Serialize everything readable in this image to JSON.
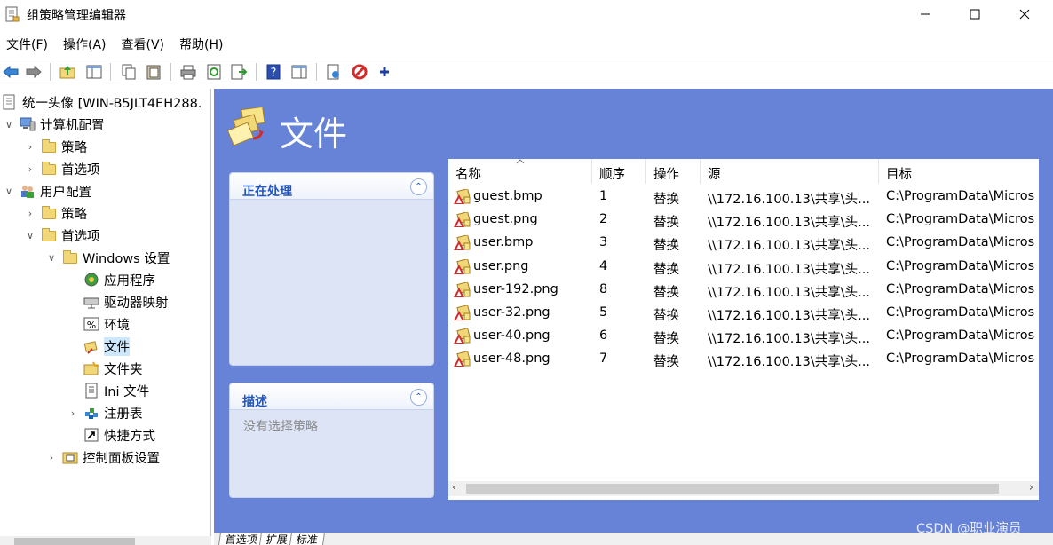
{
  "window": {
    "title": "组策略管理编辑器"
  },
  "menu": [
    "文件(F)",
    "操作(A)",
    "查看(V)",
    "帮助(H)"
  ],
  "tree": {
    "root": "统一头像 [WIN-B5JLT4EH288.",
    "computer_config": "计算机配置",
    "policies": "策略",
    "preferences": "首选项",
    "user_config": "用户配置",
    "user_policies": "策略",
    "user_preferences": "首选项",
    "windows_settings": "Windows 设置",
    "applications": "应用程序",
    "drive_maps": "驱动器映射",
    "environment": "环境",
    "files": "文件",
    "folders": "文件夹",
    "ini_files": "Ini 文件",
    "registry": "注册表",
    "shortcuts": "快捷方式",
    "control_panel": "控制面板设置"
  },
  "header": {
    "title": "文件"
  },
  "panels": {
    "processing_title": "正在处理",
    "description_title": "描述",
    "description_text": "没有选择策略"
  },
  "columns": {
    "name": "名称",
    "order": "顺序",
    "action": "操作",
    "source": "源",
    "target": "目标"
  },
  "rows": [
    {
      "name": "guest.bmp",
      "order": "1",
      "action": "替换",
      "source": "\\\\172.16.100.13\\共享\\头...",
      "target": "C:\\ProgramData\\Micros"
    },
    {
      "name": "guest.png",
      "order": "2",
      "action": "替换",
      "source": "\\\\172.16.100.13\\共享\\头...",
      "target": "C:\\ProgramData\\Micros"
    },
    {
      "name": "user.bmp",
      "order": "3",
      "action": "替换",
      "source": "\\\\172.16.100.13\\共享\\头...",
      "target": "C:\\ProgramData\\Micros"
    },
    {
      "name": "user.png",
      "order": "4",
      "action": "替换",
      "source": "\\\\172.16.100.13\\共享\\头...",
      "target": "C:\\ProgramData\\Micros"
    },
    {
      "name": "user-192.png",
      "order": "8",
      "action": "替换",
      "source": "\\\\172.16.100.13\\共享\\头...",
      "target": "C:\\ProgramData\\Micros"
    },
    {
      "name": "user-32.png",
      "order": "5",
      "action": "替换",
      "source": "\\\\172.16.100.13\\共享\\头...",
      "target": "C:\\ProgramData\\Micros"
    },
    {
      "name": "user-40.png",
      "order": "6",
      "action": "替换",
      "source": "\\\\172.16.100.13\\共享\\头...",
      "target": "C:\\ProgramData\\Micros"
    },
    {
      "name": "user-48.png",
      "order": "7",
      "action": "替换",
      "source": "\\\\172.16.100.13\\共享\\头...",
      "target": "C:\\ProgramData\\Micros"
    }
  ],
  "tabs": [
    "首选项",
    "扩展",
    "标准"
  ],
  "watermark": "CSDN @职业演员",
  "colors": {
    "pane_bg": "#6683d8",
    "panel_title": "#2155c0",
    "selection": "#cce8ff"
  }
}
